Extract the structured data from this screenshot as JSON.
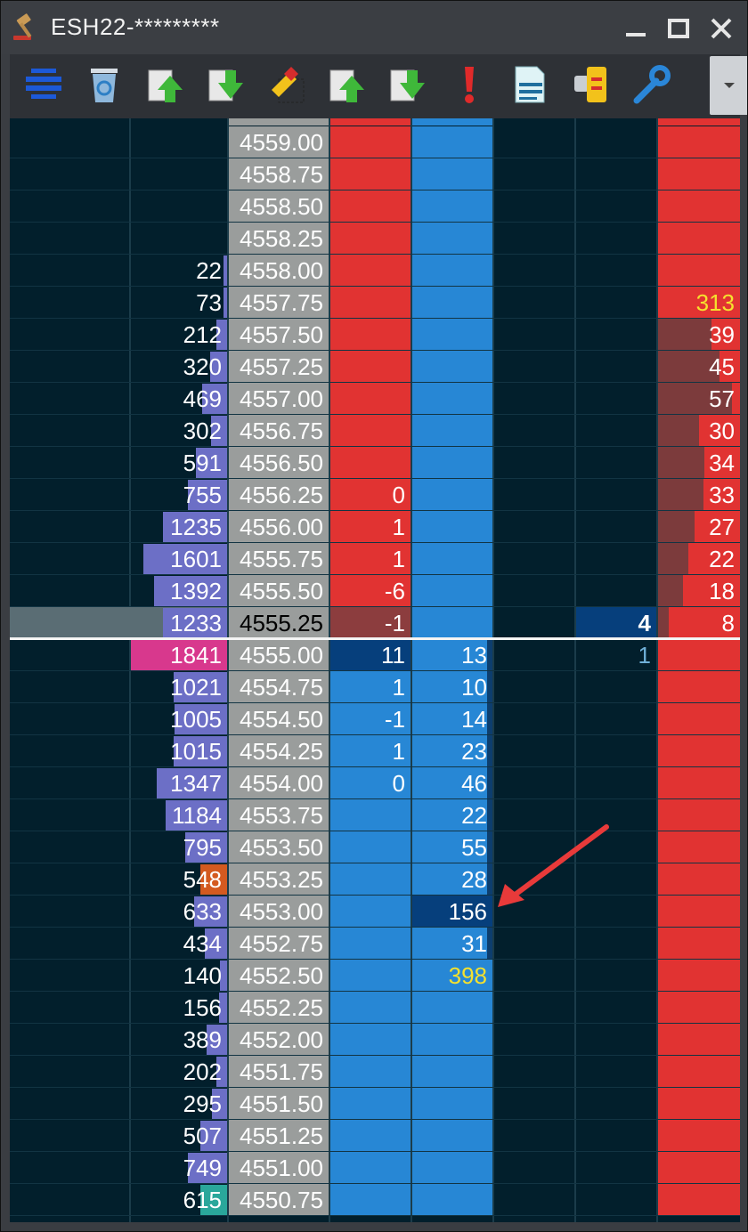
{
  "window": {
    "title": "ESH22-*********",
    "buttons": {
      "minimize": "minimize-icon",
      "maximize": "maximize-icon",
      "close": "close-icon"
    }
  },
  "toolbar": {
    "icons": [
      "center-ladder-icon",
      "recycle-bin-icon",
      "buy-arrow-icon",
      "sell-arrow-icon",
      "clear-orders-icon",
      "buy-arrow-icon",
      "sell-arrow-icon",
      "alert-icon",
      "report-icon",
      "connect-icon",
      "settings-icon"
    ],
    "dropdown": "chevron-down-icon"
  },
  "colors": {
    "background": "#021f2c",
    "ask": "#e13332",
    "bid": "#2787d5",
    "price": "#9a9d9c",
    "volume_bar": "#6c6fc6",
    "highlight_volume": "#d8388d",
    "yellow_text": "#f5e12e",
    "annotation_arrow": "#e83a3a"
  },
  "ladder": [
    {
      "price": "4559.00",
      "volume": "",
      "ask": "",
      "bid": "",
      "right": ""
    },
    {
      "price": "4558.75",
      "volume": "",
      "ask": "",
      "bid": "",
      "right": ""
    },
    {
      "price": "4558.50",
      "volume": "",
      "ask": "",
      "bid": "",
      "right": ""
    },
    {
      "price": "4558.25",
      "volume": "",
      "ask": "",
      "bid": "",
      "right": ""
    },
    {
      "price": "4558.00",
      "volume": "22",
      "ask": "",
      "bid": "",
      "right": ""
    },
    {
      "price": "4557.75",
      "volume": "73",
      "ask": "",
      "bid": "",
      "right": "313"
    },
    {
      "price": "4557.50",
      "volume": "212",
      "ask": "",
      "bid": "",
      "right": "39"
    },
    {
      "price": "4557.25",
      "volume": "320",
      "ask": "",
      "bid": "",
      "right": "45"
    },
    {
      "price": "4557.00",
      "volume": "469",
      "ask": "",
      "bid": "",
      "right": "57"
    },
    {
      "price": "4556.75",
      "volume": "302",
      "ask": "",
      "bid": "",
      "right": "30"
    },
    {
      "price": "4556.50",
      "volume": "591",
      "ask": "",
      "bid": "",
      "right": "34"
    },
    {
      "price": "4556.25",
      "volume": "755",
      "ask": "0",
      "bid": "",
      "right": "33"
    },
    {
      "price": "4556.00",
      "volume": "1235",
      "ask": "1",
      "bid": "",
      "right": "27"
    },
    {
      "price": "4555.75",
      "volume": "1601",
      "ask": "1",
      "bid": "",
      "right": "22"
    },
    {
      "price": "4555.50",
      "volume": "1392",
      "ask": "-6",
      "bid": "",
      "right": "18"
    },
    {
      "price": "4555.25",
      "volume": "1233",
      "ask": "-1",
      "bid": "",
      "order": "4",
      "right": "8"
    },
    {
      "price": "4555.00",
      "volume": "1841",
      "ask": "11",
      "bid": "13",
      "order": "1",
      "right": ""
    },
    {
      "price": "4554.75",
      "volume": "1021",
      "ask": "1",
      "bid": "10",
      "right": ""
    },
    {
      "price": "4554.50",
      "volume": "1005",
      "ask": "-1",
      "bid": "14",
      "right": ""
    },
    {
      "price": "4554.25",
      "volume": "1015",
      "ask": "1",
      "bid": "23",
      "right": ""
    },
    {
      "price": "4554.00",
      "volume": "1347",
      "ask": "0",
      "bid": "46",
      "right": ""
    },
    {
      "price": "4553.75",
      "volume": "1184",
      "ask": "",
      "bid": "22",
      "right": ""
    },
    {
      "price": "4553.50",
      "volume": "795",
      "ask": "",
      "bid": "55",
      "right": ""
    },
    {
      "price": "4553.25",
      "volume": "548",
      "ask": "",
      "bid": "28",
      "right": ""
    },
    {
      "price": "4553.00",
      "volume": "633",
      "ask": "",
      "bid": "156",
      "right": ""
    },
    {
      "price": "4552.75",
      "volume": "434",
      "ask": "",
      "bid": "31",
      "right": ""
    },
    {
      "price": "4552.50",
      "volume": "140",
      "ask": "",
      "bid": "398",
      "right": ""
    },
    {
      "price": "4552.25",
      "volume": "156",
      "ask": "",
      "bid": "",
      "right": ""
    },
    {
      "price": "4552.00",
      "volume": "389",
      "ask": "",
      "bid": "",
      "right": ""
    },
    {
      "price": "4551.75",
      "volume": "202",
      "ask": "",
      "bid": "",
      "right": ""
    },
    {
      "price": "4551.50",
      "volume": "295",
      "ask": "",
      "bid": "",
      "right": ""
    },
    {
      "price": "4551.25",
      "volume": "507",
      "ask": "",
      "bid": "",
      "right": ""
    },
    {
      "price": "4551.00",
      "volume": "749",
      "ask": "",
      "bid": "",
      "right": ""
    },
    {
      "price": "4550.75",
      "volume": "615",
      "ask": "",
      "bid": "",
      "right": ""
    }
  ]
}
